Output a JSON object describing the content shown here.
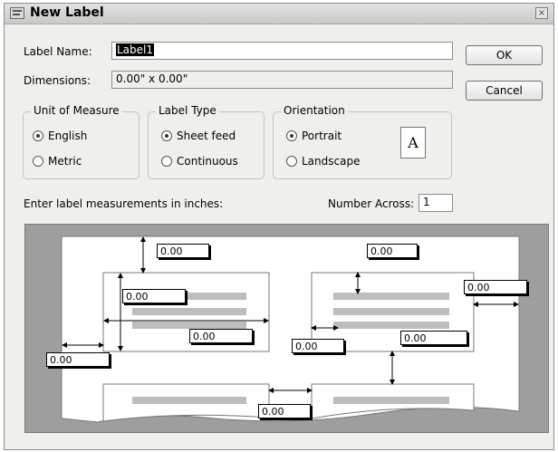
{
  "window": {
    "title": "New Label",
    "close_glyph": "×"
  },
  "form": {
    "label_name_label": "Label Name:",
    "label_name_value": "Label1",
    "dimensions_label": "Dimensions:",
    "dimensions_value": "0.00\" x 0.00\""
  },
  "buttons": {
    "ok": "OK",
    "cancel": "Cancel"
  },
  "unit_of_measure": {
    "title": "Unit of Measure",
    "options": [
      "English",
      "Metric"
    ],
    "selected": "English"
  },
  "label_type": {
    "title": "Label Type",
    "options": [
      "Sheet feed",
      "Continuous"
    ],
    "selected": "Sheet feed"
  },
  "orientation": {
    "title": "Orientation",
    "options": [
      "Portrait",
      "Landscape"
    ],
    "selected": "Portrait",
    "icon_letter": "A"
  },
  "measurements": {
    "instruction": "Enter label measurements in inches:",
    "number_across_label": "Number Across:",
    "number_across_value": "1"
  },
  "preview": {
    "top_margin": "0.00",
    "label_height": "0.00",
    "label_width": "0.00",
    "side_margin": "0.00",
    "horizontal_spacing": "0.00",
    "vertical_spacing": "0.00",
    "page_width": "0.00",
    "right_margin": "0.00",
    "row_spacing": "0.00"
  }
}
